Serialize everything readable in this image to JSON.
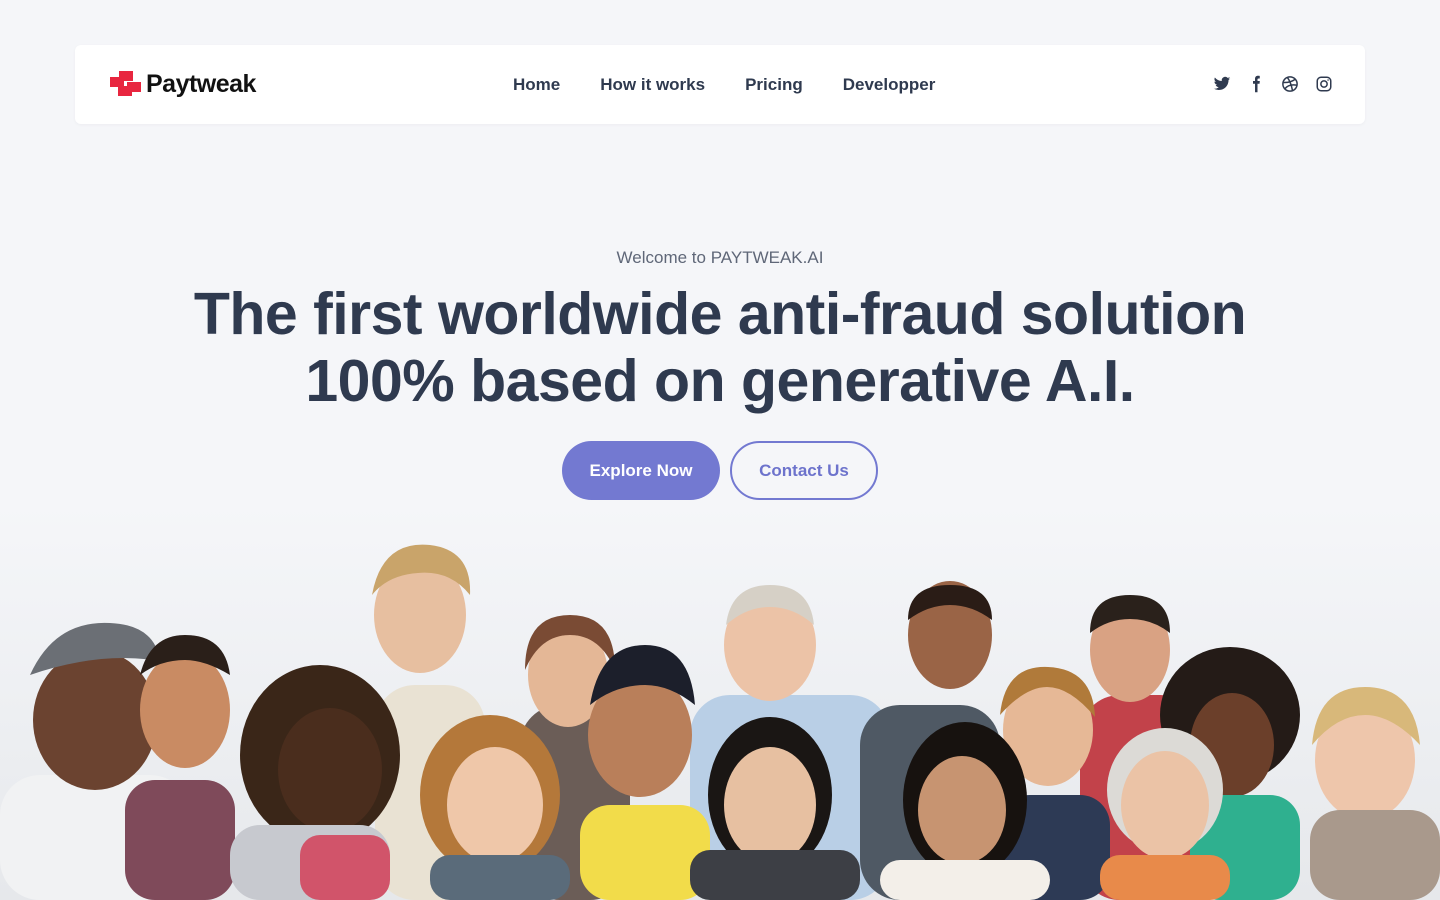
{
  "brand": {
    "name": "Paytweak",
    "logo_color": "#e8263f"
  },
  "nav": {
    "items": [
      {
        "label": "Home"
      },
      {
        "label": "How it works"
      },
      {
        "label": "Pricing"
      },
      {
        "label": "Developper"
      }
    ]
  },
  "socials": [
    "twitter-icon",
    "facebook-icon",
    "dribbble-icon",
    "instagram-icon"
  ],
  "hero": {
    "eyebrow": "Welcome to PAYTWEAK.AI",
    "headline_line1": "The first worldwide anti-fraud solution",
    "headline_line2": "100% based on generative A.I.",
    "primary_cta": "Explore Now",
    "secondary_cta": "Contact Us"
  },
  "colors": {
    "accent": "#7379d1",
    "text": "#2f3a4f",
    "background": "#f5f6f9"
  },
  "image": {
    "subject": "group-photo"
  }
}
